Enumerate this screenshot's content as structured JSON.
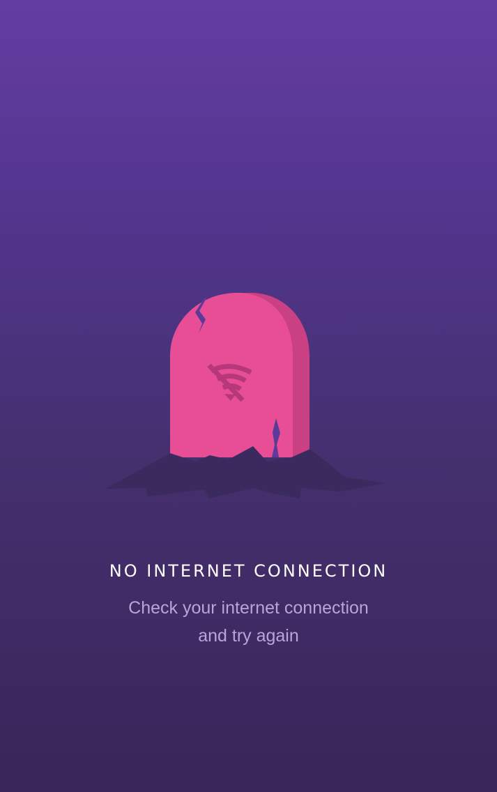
{
  "colors": {
    "background_top": "#643da3",
    "background_bottom": "#3a2559",
    "tombstone_face": "#e74e96",
    "tombstone_side": "#c94182",
    "crack": "#5b3a9a",
    "ground": "#3b2a5d",
    "title_text": "#ffffff",
    "message_text": "#b9a6d9"
  },
  "illustration": {
    "icon": "wifi-off-icon"
  },
  "error": {
    "title": "NO INTERNET CONNECTION",
    "message_line1": "Check your internet connection",
    "message_line2": "and try again"
  }
}
